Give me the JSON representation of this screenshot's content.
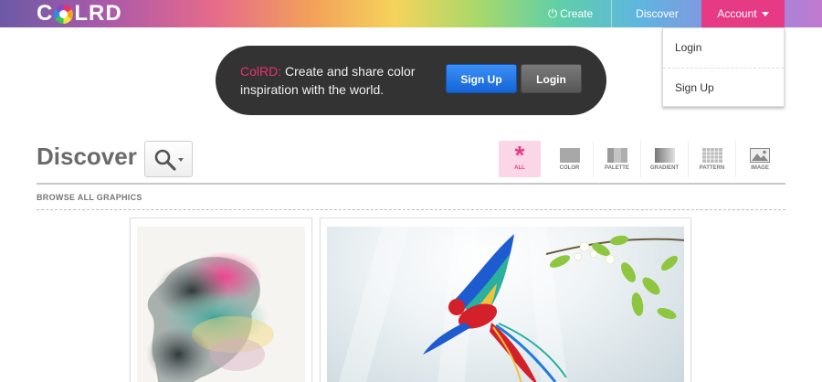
{
  "topbar": {
    "logo_text": "COLRD",
    "nav": {
      "create_label": "Create",
      "discover_label": "Discover",
      "account_label": "Account"
    }
  },
  "account_menu": {
    "items": [
      {
        "label": "Login"
      },
      {
        "label": "Sign Up"
      }
    ]
  },
  "hero": {
    "brand": "ColRD:",
    "tagline": "Create and share color inspiration with the world.",
    "signup_label": "Sign Up",
    "login_label": "Login"
  },
  "discover": {
    "title": "Discover",
    "filters": [
      {
        "label": "ALL",
        "icon": "asterisk-icon",
        "active": true
      },
      {
        "label": "COLOR",
        "icon": "color-swatch-icon"
      },
      {
        "label": "PALETTE",
        "icon": "palette-icon"
      },
      {
        "label": "GRADIENT",
        "icon": "gradient-icon"
      },
      {
        "label": "PATTERN",
        "icon": "pattern-grid-icon"
      },
      {
        "label": "IMAGE",
        "icon": "image-icon"
      }
    ],
    "section_label": "BROWSE ALL GRAPHICS"
  },
  "colors": {
    "accent": "#e63a84",
    "signup_blue": "#1f6fe5",
    "hero_bg": "#333333"
  }
}
